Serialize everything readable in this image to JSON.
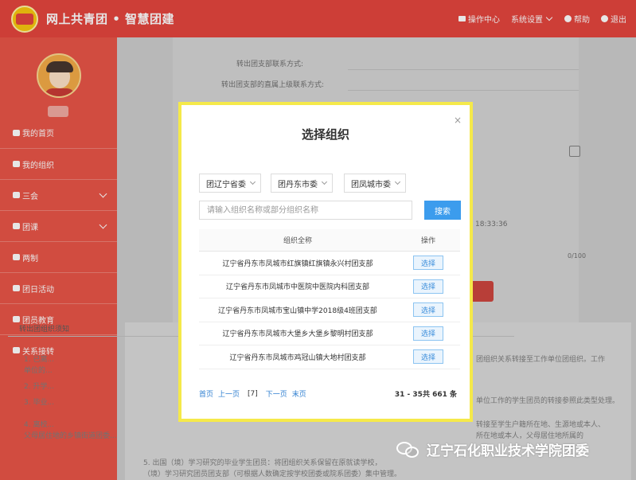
{
  "header": {
    "title": "网上共青团 • 智慧团建",
    "nav": [
      {
        "label": "操作中心",
        "icon": "envelope-icon"
      },
      {
        "label": "系统设置",
        "icon": "chevron-down-icon"
      },
      {
        "label": "帮助",
        "icon": "help-icon"
      },
      {
        "label": "退出",
        "icon": "power-icon"
      }
    ]
  },
  "sidebar": {
    "items": [
      {
        "label": "我的首页",
        "icon": "home-icon"
      },
      {
        "label": "我的组织",
        "icon": "org-icon"
      },
      {
        "label": "三会",
        "icon": "meeting-icon",
        "expandable": true
      },
      {
        "label": "团课",
        "icon": "class-icon",
        "expandable": true
      },
      {
        "label": "两制",
        "icon": "system-icon"
      },
      {
        "label": "团日活动",
        "icon": "activity-icon"
      },
      {
        "label": "团员教育",
        "icon": "education-icon"
      },
      {
        "label": "关系接转",
        "icon": "transfer-icon"
      }
    ]
  },
  "background": {
    "labels": [
      "转出团支部联系方式:",
      "转出团支部的直属上级联系方式:"
    ],
    "timestamp": "18:33:36",
    "counter": "0/100",
    "rules_title": "转出团组织须知",
    "rules": [
      "1. 已离...",
      "单位的...",
      "2. 升学...",
      "3. 毕业...",
      "4. 离校...",
      "父母居住地的乡镇街道团委..."
    ],
    "rules_fragments": [
      "团组织关系转接至工作单位团组织。工作",
      "单位工作的学生团员的转接参照此类型处理。",
      "转接至学生户籍所在地、生源地或本人、",
      "所在地或本人，父母居住地所属的",
      "5. 出国（境）学习研究的毕业学生团员：将团组织关系保留在原就读学校，",
      "（境）学习研究团员团支部（可根据人数确定按学校团委或院系团委）集中管理。"
    ]
  },
  "modal": {
    "title": "选择组织",
    "close": "×",
    "selects": [
      "团辽宁省委",
      "团丹东市委",
      "团凤城市委"
    ],
    "search": {
      "placeholder": "请输入组织名称或部分组织名称",
      "value": "",
      "button": "搜索"
    },
    "table": {
      "headers": [
        "组织全称",
        "操作"
      ],
      "rows": [
        {
          "name": "辽宁省丹东市凤城市红旗镇红旗镇永兴村团支部",
          "action": "选择"
        },
        {
          "name": "辽宁省丹东市凤城市中医院中医院内科团支部",
          "action": "选择"
        },
        {
          "name": "辽宁省丹东市凤城市宝山镇中学2018级4班团支部",
          "action": "选择"
        },
        {
          "name": "辽宁省丹东市凤城市大堡乡大堡乡黎明村团支部",
          "action": "选择"
        },
        {
          "name": "辽宁省丹东市凤城市鸡冠山镇大地村团支部",
          "action": "选择"
        }
      ]
    },
    "pager": {
      "first": "首页",
      "prev": "上一页",
      "current": "[7]",
      "next": "下一页",
      "last": "末页",
      "info": "31 - 35共 661 条"
    }
  },
  "watermark": {
    "text": "辽宁石化职业技术学院团委"
  }
}
